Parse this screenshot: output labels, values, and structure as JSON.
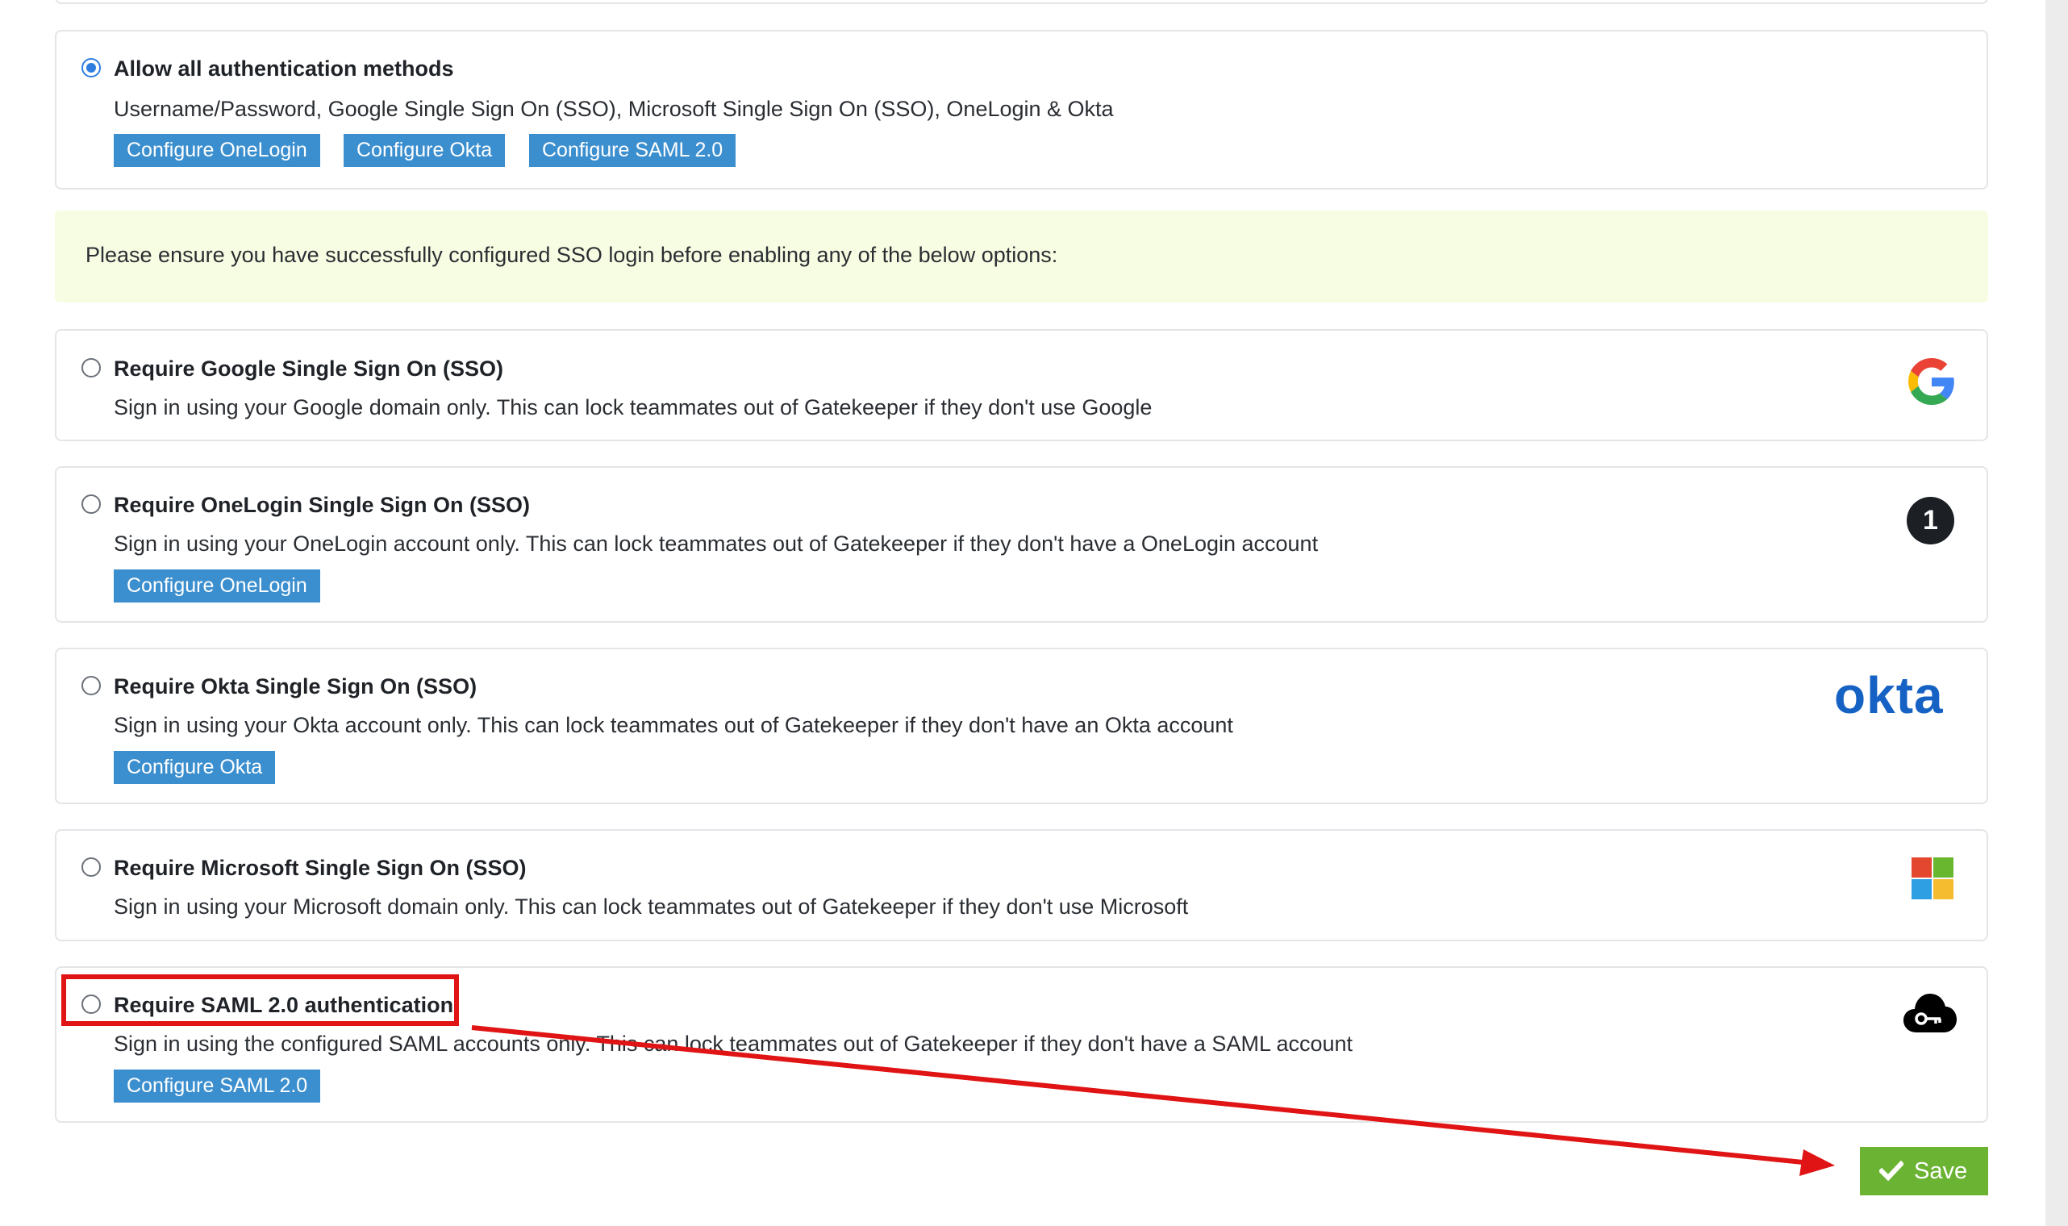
{
  "allow_all": {
    "title": "Allow all authentication methods",
    "description": "Username/Password, Google Single Sign On (SSO), Microsoft Single Sign On (SSO), OneLogin & Okta",
    "buttons": [
      "Configure OneLogin",
      "Configure Okta",
      "Configure SAML 2.0"
    ],
    "selected": true
  },
  "notice": {
    "text": "Please ensure you have successfully configured SSO login before enabling any of the below options:"
  },
  "options": {
    "google": {
      "title": "Require Google Single Sign On (SSO)",
      "description": "Sign in using your Google domain only. This can lock teammates out of Gatekeeper if they don't use Google",
      "logo": "google-logo"
    },
    "onelogin": {
      "title": "Require OneLogin Single Sign On (SSO)",
      "description": "Sign in using your OneLogin account only. This can lock teammates out of Gatekeeper if they don't have a OneLogin account",
      "button": "Configure OneLogin",
      "logo": "onelogin-logo",
      "logo_glyph": "1"
    },
    "okta": {
      "title": "Require Okta Single Sign On (SSO)",
      "description": "Sign in using your Okta account only. This can lock teammates out of Gatekeeper if they don't have an Okta account",
      "button": "Configure Okta",
      "logo": "okta-logo",
      "logo_text": "okta"
    },
    "microsoft": {
      "title": "Require Microsoft Single Sign On (SSO)",
      "description": "Sign in using your Microsoft domain only. This can lock teammates out of Gatekeeper if they don't use Microsoft",
      "logo": "microsoft-logo"
    },
    "saml": {
      "title": "Require SAML 2.0 authentication",
      "description": "Sign in using the configured SAML accounts only. This can lock teammates out of Gatekeeper if they don't have a SAML account",
      "button": "Configure SAML 2.0",
      "logo": "cloud-key-icon"
    }
  },
  "save": {
    "label": "Save",
    "icon": "check-icon"
  },
  "colors": {
    "button_blue": "#3c8fcf",
    "save_green": "#6bb333",
    "radio_selected": "#2f7de1",
    "notice_bg": "#f7fde2",
    "annotation_red": "#e01414",
    "okta_blue": "#1662c4"
  }
}
